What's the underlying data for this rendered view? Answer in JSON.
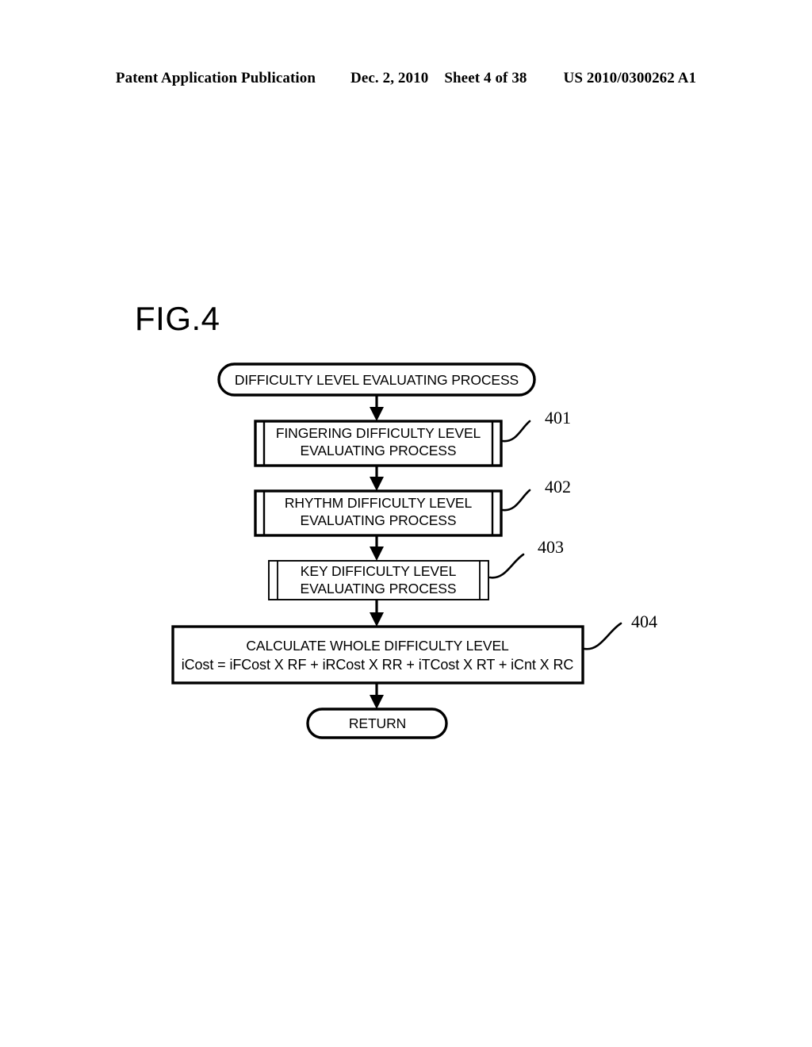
{
  "header": {
    "publication": "Patent Application Publication",
    "date": "Dec. 2, 2010",
    "sheet": "Sheet 4 of 38",
    "patent_number": "US 2010/0300262 A1"
  },
  "figure": {
    "title": "FIG.4",
    "start_node": "DIFFICULTY LEVEL EVALUATING PROCESS",
    "end_node": "RETURN",
    "steps": [
      {
        "ref": "401",
        "line1": "FINGERING DIFFICULTY LEVEL",
        "line2": "EVALUATING PROCESS",
        "shape": "predefined-process"
      },
      {
        "ref": "402",
        "line1": "RHYTHM DIFFICULTY LEVEL",
        "line2": "EVALUATING PROCESS",
        "shape": "predefined-process"
      },
      {
        "ref": "403",
        "line1": "KEY DIFFICULTY LEVEL",
        "line2": "EVALUATING PROCESS",
        "shape": "predefined-process"
      },
      {
        "ref": "404",
        "line1": "CALCULATE WHOLE DIFFICULTY LEVEL",
        "line2": "iCost = iFCost X RF + iRCost X RR + iTCost X RT + iCnt X RC",
        "shape": "process"
      }
    ]
  },
  "colors": {
    "ink": "#000000",
    "paper": "#ffffff"
  }
}
